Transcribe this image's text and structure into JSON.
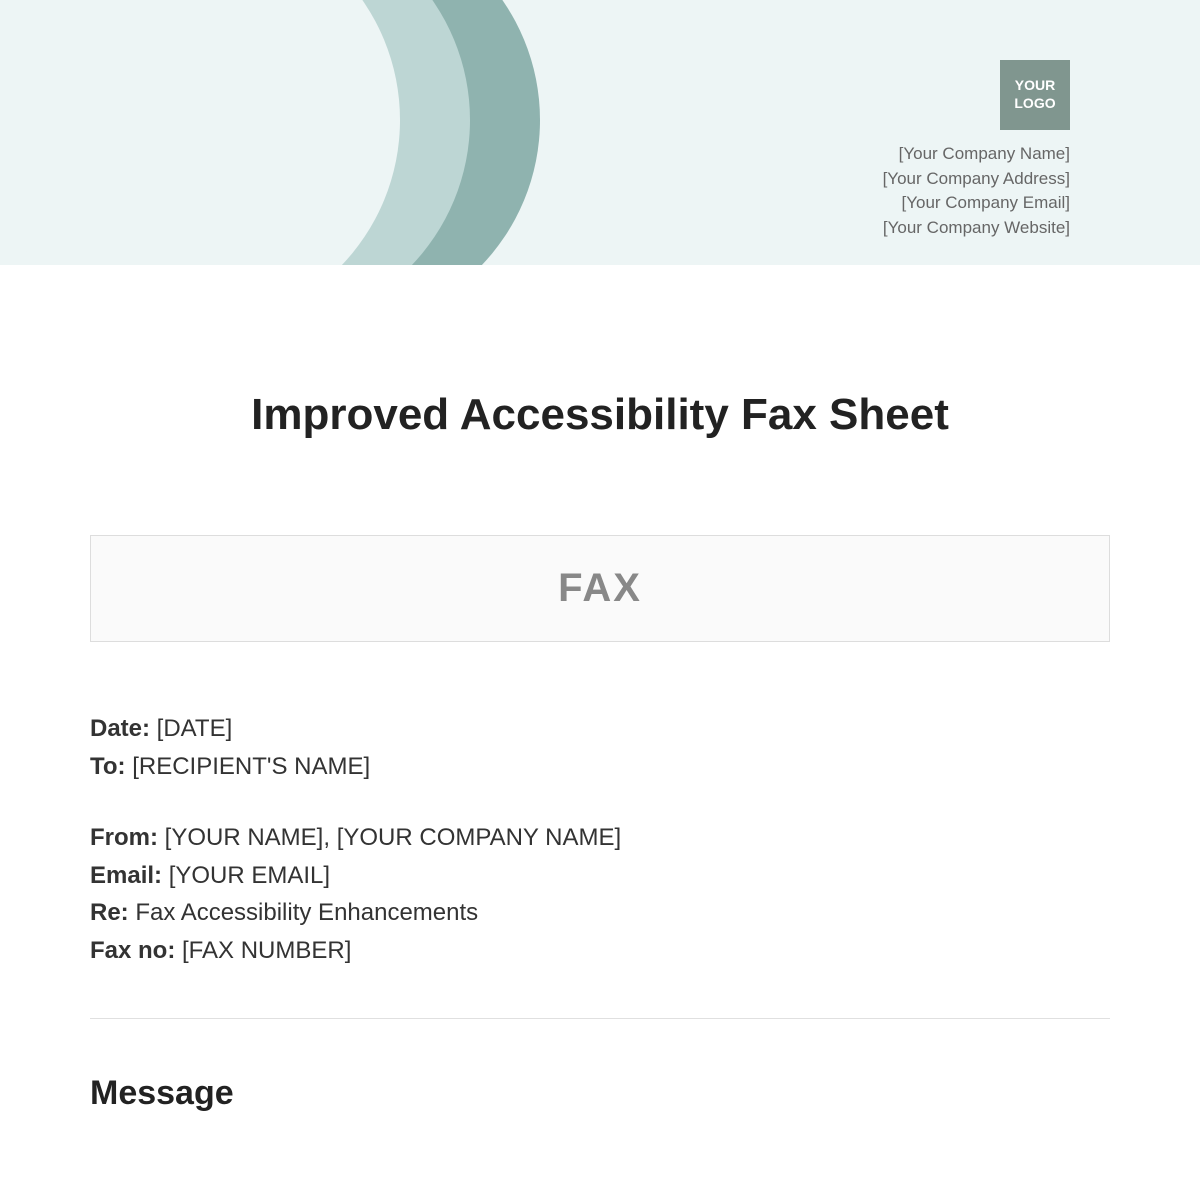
{
  "header": {
    "logo_line1": "YOUR",
    "logo_line2": "LOGO",
    "company": {
      "name": "[Your Company Name]",
      "address": "[Your Company Address]",
      "email": "[Your Company Email]",
      "website": "[Your Company Website]"
    }
  },
  "title": "Improved Accessibility Fax Sheet",
  "fax_box": "FAX",
  "fields": {
    "date_label": "Date:",
    "date_value": " [DATE]",
    "to_label": "To:",
    "to_value": " [RECIPIENT'S NAME]",
    "from_label": "From:",
    "from_value": " [YOUR NAME], [YOUR COMPANY NAME]",
    "email_label": "Email:",
    "email_value": " [YOUR EMAIL]",
    "re_label": "Re:",
    "re_value": " Fax Accessibility Enhancements",
    "faxno_label": "Fax no:",
    "faxno_value": " [FAX NUMBER]"
  },
  "message_heading": "Message"
}
